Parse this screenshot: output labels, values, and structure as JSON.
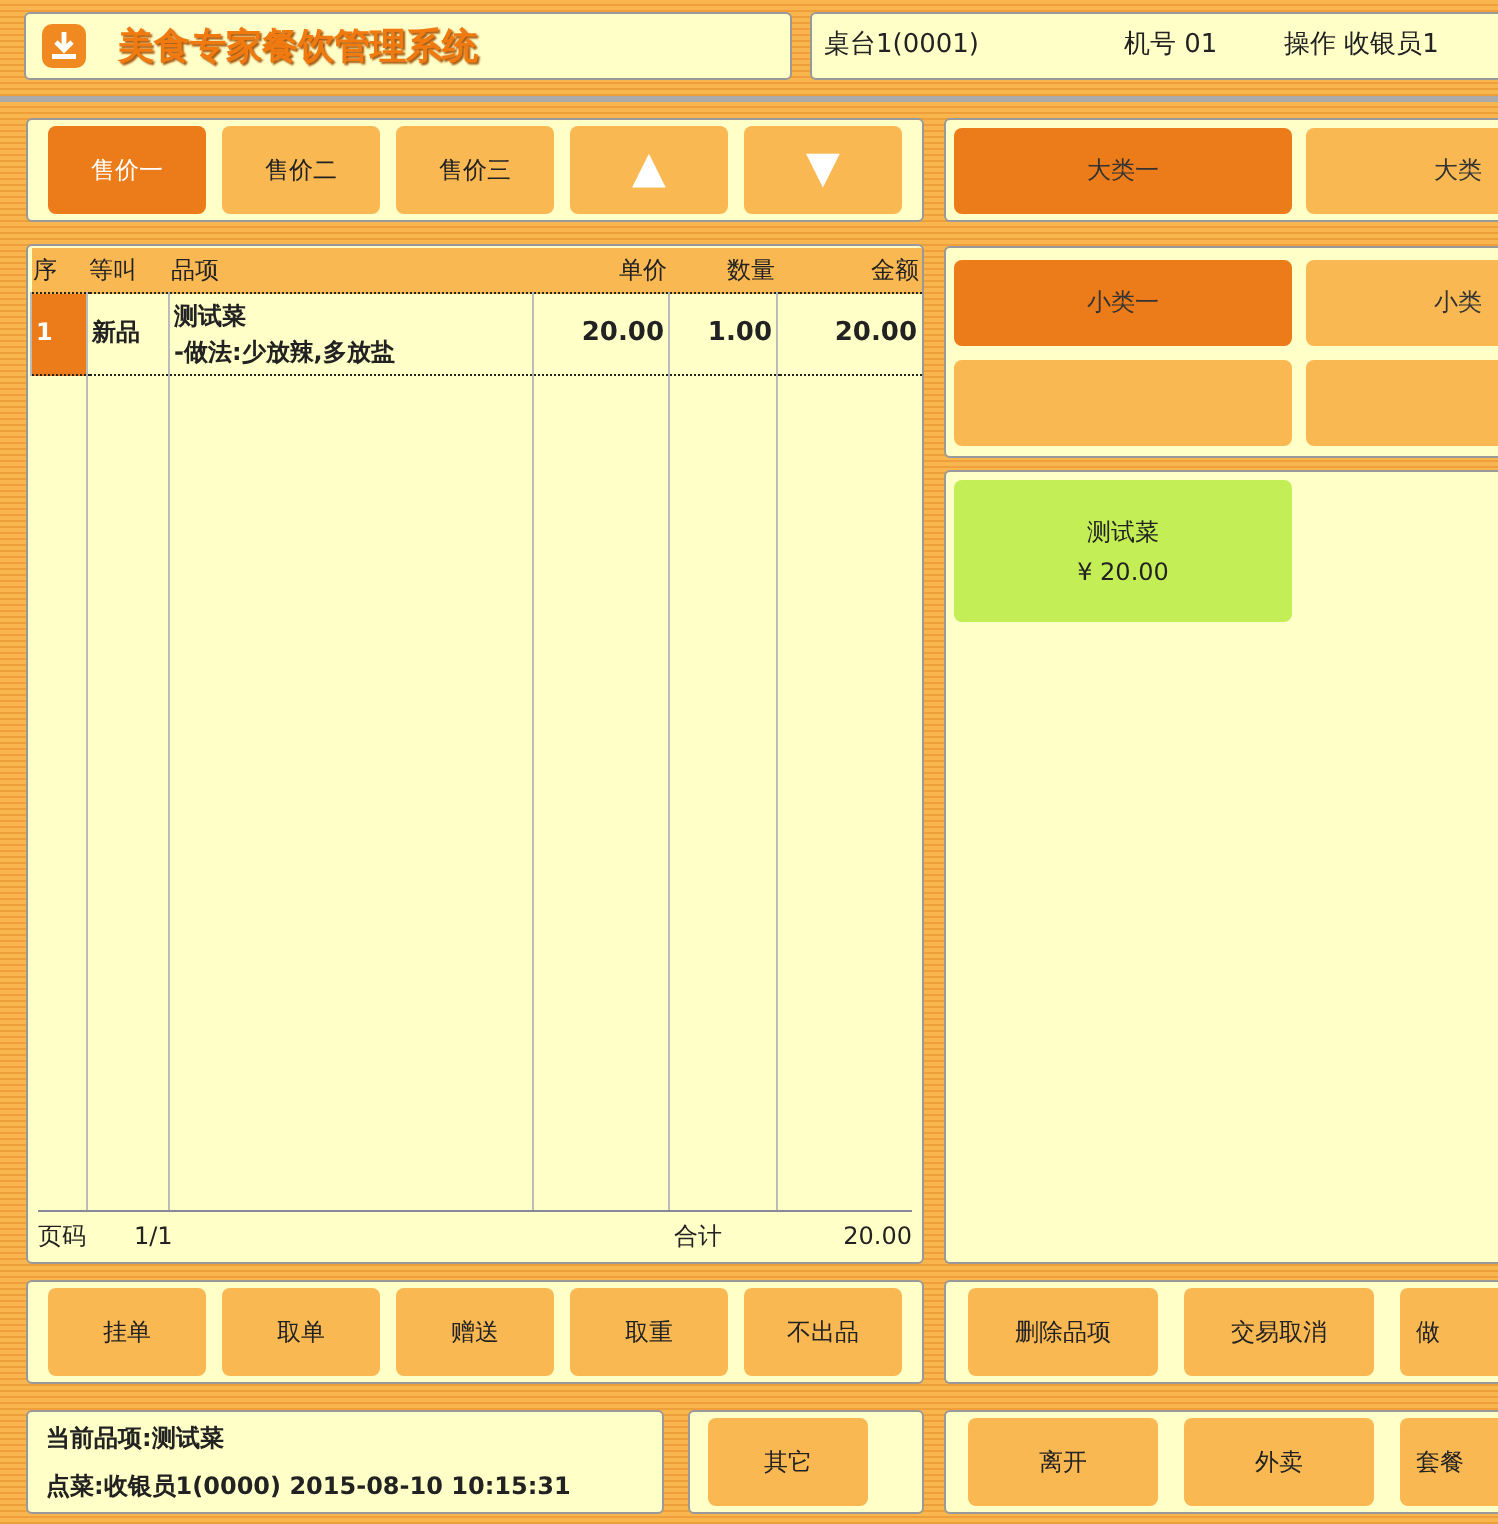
{
  "header": {
    "title": "美食专家餐饮管理系统",
    "table": "桌台1(0001)",
    "terminal_label": "机号",
    "terminal": "01",
    "operator_label": "操作",
    "operator": "收银员1"
  },
  "price_tabs": [
    {
      "label": "售价一",
      "selected": true
    },
    {
      "label": "售价二",
      "selected": false
    },
    {
      "label": "售价三",
      "selected": false
    }
  ],
  "nav_buttons": [
    "▲",
    "▼"
  ],
  "order_table": {
    "columns": [
      "序",
      "等叫",
      "品项",
      "单价",
      "数量",
      "金额"
    ],
    "rows": [
      {
        "no": "1",
        "status": "新品",
        "item": "测试菜",
        "note": "-做法:少放辣,多放盐",
        "price": "20.00",
        "qty": "1.00",
        "amount": "20.00",
        "selected": true
      }
    ],
    "footer": {
      "page_label": "页码",
      "page": "1/1",
      "total_label": "合计",
      "total": "20.00"
    }
  },
  "actions": [
    "挂单",
    "取单",
    "赠送",
    "取重",
    "不出品"
  ],
  "status": {
    "current": "当前品项:测试菜",
    "order": "点菜:收银员1(0000) 2015-08-10 10:15:31"
  },
  "other_button": "其它",
  "categories": [
    {
      "label": "大类一",
      "selected": true
    },
    {
      "label": "大类",
      "selected": false
    }
  ],
  "subcategories": [
    {
      "label": "小类一",
      "selected": true
    },
    {
      "label": "小类",
      "selected": false
    },
    {
      "selected": false
    },
    {
      "selected": false
    }
  ],
  "dishes": [
    {
      "name": "测试菜",
      "price": "¥ 20.00"
    }
  ],
  "right_actions": [
    "删除品项",
    "交易取消",
    "做"
  ],
  "bottom_actions": [
    "离开",
    "外卖",
    "套餐"
  ]
}
